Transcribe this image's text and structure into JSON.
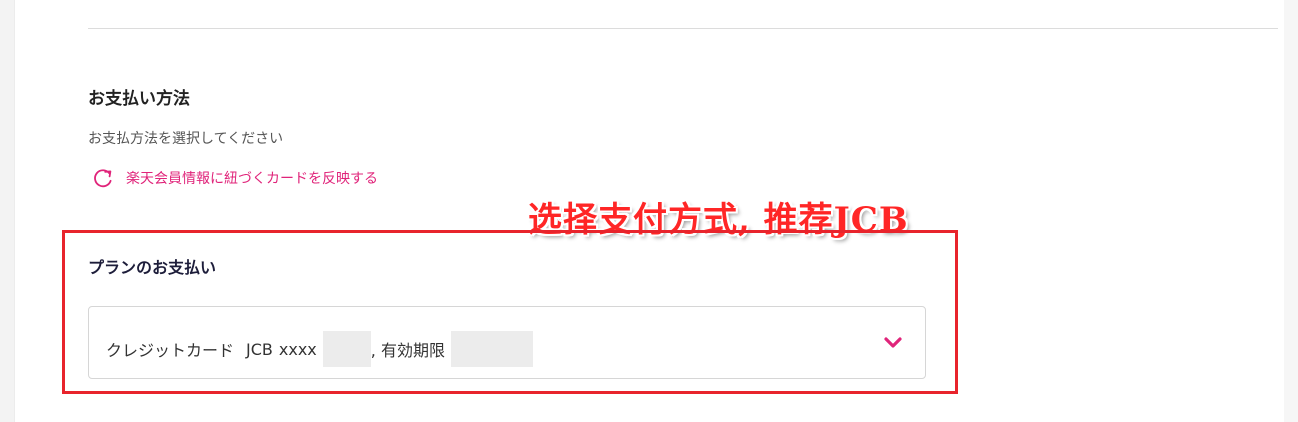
{
  "payment_section": {
    "title": "お支払い方法",
    "subtitle": "お支払方法を選択してください",
    "reflect_link_label": "楽天会員情報に紐づくカードを反映する"
  },
  "annotation": {
    "text": "选择支付方式, 推荐JCB"
  },
  "plan_payment": {
    "title": "プランのお支払い",
    "selected_method": "クレジットカード",
    "card_brand": "JCB",
    "card_mask": "xxxx",
    "separator": ", 有効期限"
  },
  "colors": {
    "accent_pink": "#e0247a",
    "annotation_red": "#ff2626",
    "highlight_border": "#e8242c"
  },
  "icons": {
    "reflect": "refresh-icon",
    "dropdown": "chevron-down-icon"
  }
}
